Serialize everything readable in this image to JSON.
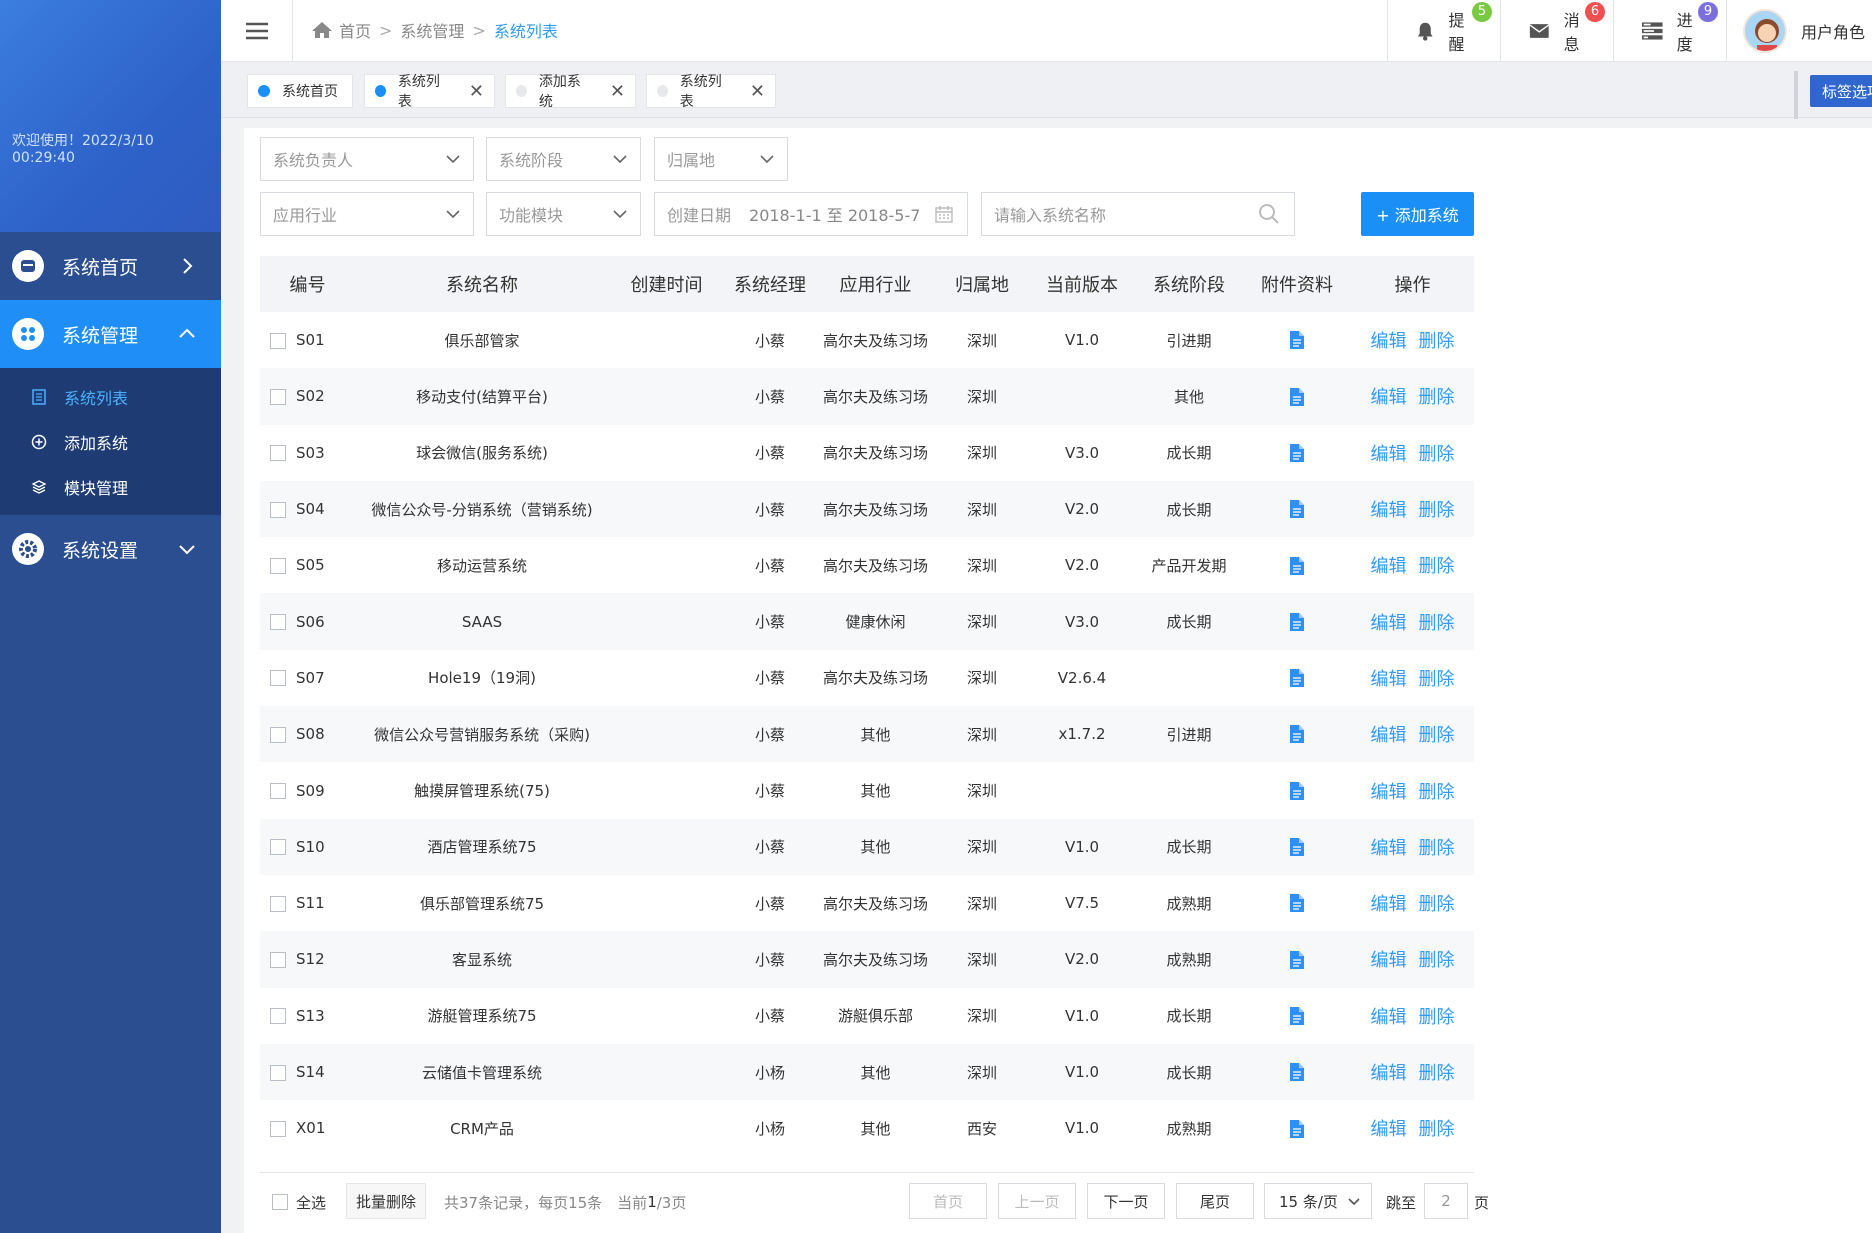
{
  "sidebar": {
    "welcome": "欢迎使用！2022/3/10 00:29:40",
    "menu": [
      {
        "label": "系统首页"
      },
      {
        "label": "系统管理"
      },
      {
        "label": "系统设置"
      }
    ],
    "submenu": [
      {
        "label": "系统列表"
      },
      {
        "label": "添加系统"
      },
      {
        "label": "模块管理"
      }
    ]
  },
  "topbar": {
    "breadcrumb": [
      "首页",
      "系统管理",
      "系统列表"
    ],
    "remind": {
      "label": "提醒",
      "count": "5"
    },
    "message": {
      "label": "消息",
      "count": "6"
    },
    "progress": {
      "label": "进度",
      "count": "9"
    },
    "user": {
      "label": "用户角色"
    }
  },
  "tabs": [
    {
      "label": "系统首页"
    },
    {
      "label": "系统列表"
    },
    {
      "label": "添加系统"
    },
    {
      "label": "系统列表"
    }
  ],
  "tag_options": "标签选项",
  "filters": {
    "owner": "系统负责人",
    "stage": "系统阶段",
    "location": "归属地",
    "industry": "应用行业",
    "module": "功能模块",
    "date_label": "创建日期",
    "date_value": "2018-1-1 至 2018-5-7",
    "search_placeholder": "请输入系统名称",
    "add_button": "+  添加系统"
  },
  "table": {
    "headers": [
      "编号",
      "系统名称",
      "创建时间",
      "系统经理",
      "应用行业",
      "归属地",
      "当前版本",
      "系统阶段",
      "附件资料",
      "操作"
    ],
    "rows": [
      [
        "S01",
        "俱乐部管家",
        "",
        "小蔡",
        "高尔夫及练习场",
        "深圳",
        "V1.0",
        "引进期"
      ],
      [
        "S02",
        "移动支付(结算平台)",
        "",
        "小蔡",
        "高尔夫及练习场",
        "深圳",
        "",
        "其他"
      ],
      [
        "S03",
        "球会微信(服务系统)",
        "",
        "小蔡",
        "高尔夫及练习场",
        "深圳",
        "V3.0",
        "成长期"
      ],
      [
        "S04",
        "微信公众号-分销系统（营销系统)",
        "",
        "小蔡",
        "高尔夫及练习场",
        "深圳",
        "V2.0",
        "成长期"
      ],
      [
        "S05",
        "移动运营系统",
        "",
        "小蔡",
        "高尔夫及练习场",
        "深圳",
        "V2.0",
        "产品开发期"
      ],
      [
        "S06",
        "SAAS",
        "",
        "小蔡",
        "健康休闲",
        "深圳",
        "V3.0",
        "成长期"
      ],
      [
        "S07",
        "Hole19（19洞)",
        "",
        "小蔡",
        "高尔夫及练习场",
        "深圳",
        "V2.6.4",
        ""
      ],
      [
        "S08",
        "微信公众号营销服务系统（采购)",
        "",
        "小蔡",
        "其他",
        "深圳",
        "x1.7.2",
        "引进期"
      ],
      [
        "S09",
        "触摸屏管理系统(75)",
        "",
        "小蔡",
        "其他",
        "深圳",
        "",
        ""
      ],
      [
        "S10",
        "酒店管理系统75",
        "",
        "小蔡",
        "其他",
        "深圳",
        "V1.0",
        "成长期"
      ],
      [
        "S11",
        "俱乐部管理系统75",
        "",
        "小蔡",
        "高尔夫及练习场",
        "深圳",
        "V7.5",
        "成熟期"
      ],
      [
        "S12",
        "客显系统",
        "",
        "小蔡",
        "高尔夫及练习场",
        "深圳",
        "V2.0",
        "成熟期"
      ],
      [
        "S13",
        "游艇管理系统75",
        "",
        "小蔡",
        "游艇俱乐部",
        "深圳",
        "V1.0",
        "成长期"
      ],
      [
        "S14",
        "云储值卡管理系统",
        "",
        "小杨",
        "其他",
        "深圳",
        "V1.0",
        "成长期"
      ],
      [
        "X01",
        "CRM产品",
        "",
        "小杨",
        "其他",
        "西安",
        "V1.0",
        "成熟期"
      ]
    ],
    "edit_label": "编辑",
    "delete_label": "删除"
  },
  "footer": {
    "select_all": "全选",
    "batch_delete": "批量删除",
    "summary_prefix": "共37条记录，每页15条　当前",
    "current_page": "1",
    "summary_suffix": "/3页",
    "first": "首页",
    "prev": "上一页",
    "next": "下一页",
    "last": "尾页",
    "page_size": "15 条/页",
    "jump_label": "跳至",
    "jump_value": "2",
    "page_unit": "页"
  },
  "colors": {
    "sidebar": "#2a4e8f",
    "active_menu": "#1f8ff7",
    "link": "#2f9bff",
    "badge_green": "#7ac943",
    "badge_red": "#f05050",
    "badge_purple": "#7b6fe0"
  }
}
